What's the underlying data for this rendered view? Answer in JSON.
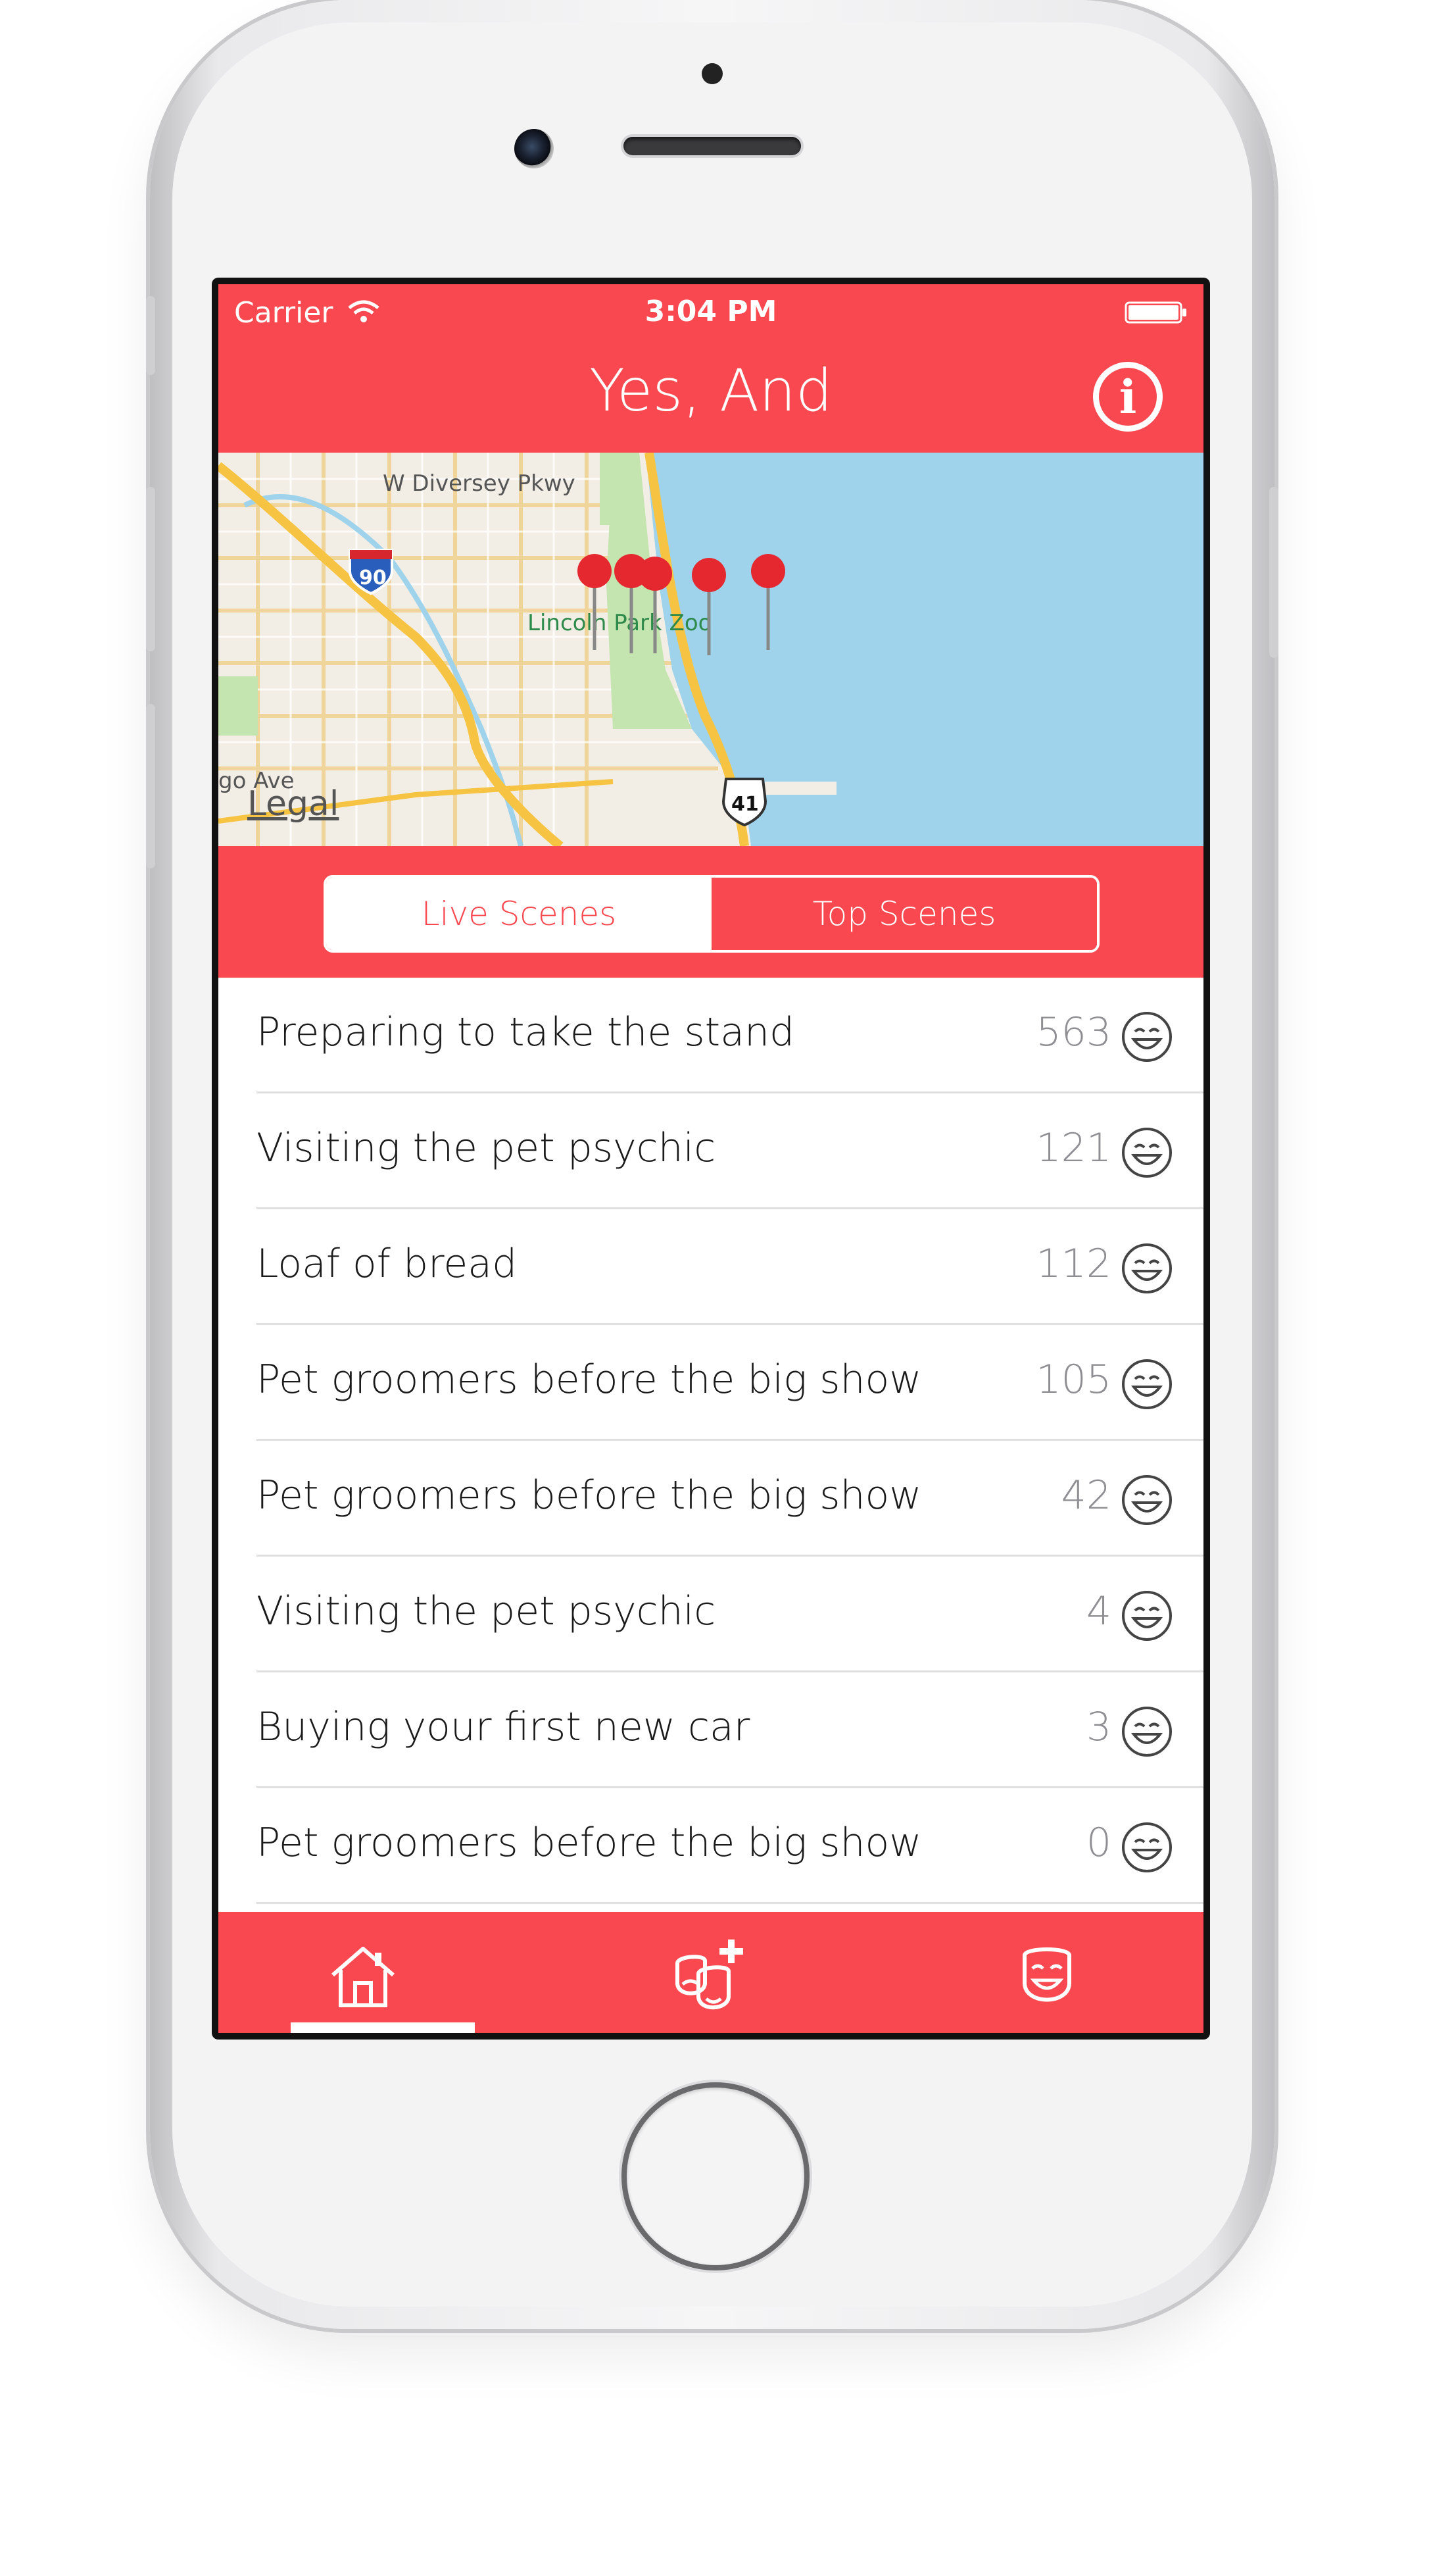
{
  "status_bar": {
    "carrier": "Carrier",
    "time": "3:04 PM"
  },
  "nav": {
    "title": "Yes, And",
    "info_icon": "info-icon"
  },
  "map": {
    "labels": {
      "road_top": "W Diversey Pkwy",
      "zoo": "Lincoln Park Zoo",
      "left_avenue": "go Ave",
      "interstate": "90",
      "us_route": "41"
    },
    "legal": "Legal",
    "pin_count": 5,
    "colors": {
      "water": "#9fd3ec",
      "land": "#f2eee5",
      "park": "#c4e4b0",
      "highway": "#f6c442"
    }
  },
  "segmented": {
    "options": [
      "Live Scenes",
      "Top Scenes"
    ],
    "selected": "Live Scenes"
  },
  "scenes": [
    {
      "title": "Preparing to take the stand",
      "count": "563"
    },
    {
      "title": "Visiting the pet psychic",
      "count": "121"
    },
    {
      "title": "Loaf of bread",
      "count": "112"
    },
    {
      "title": "Pet groomers before the big show",
      "count": "105"
    },
    {
      "title": "Pet groomers before the big show",
      "count": "42"
    },
    {
      "title": "Visiting the pet psychic",
      "count": "4"
    },
    {
      "title": "Buying your first new car",
      "count": "3"
    },
    {
      "title": "Pet groomers before the big show",
      "count": "0"
    }
  ],
  "tabs": [
    {
      "icon": "home-icon",
      "selected": true
    },
    {
      "icon": "add-scene-masks-icon",
      "selected": false
    },
    {
      "icon": "mask-icon",
      "selected": false
    }
  ],
  "colors": {
    "accent": "#fa4850",
    "text": "#1a1a1a",
    "count": "#8e8e93"
  }
}
